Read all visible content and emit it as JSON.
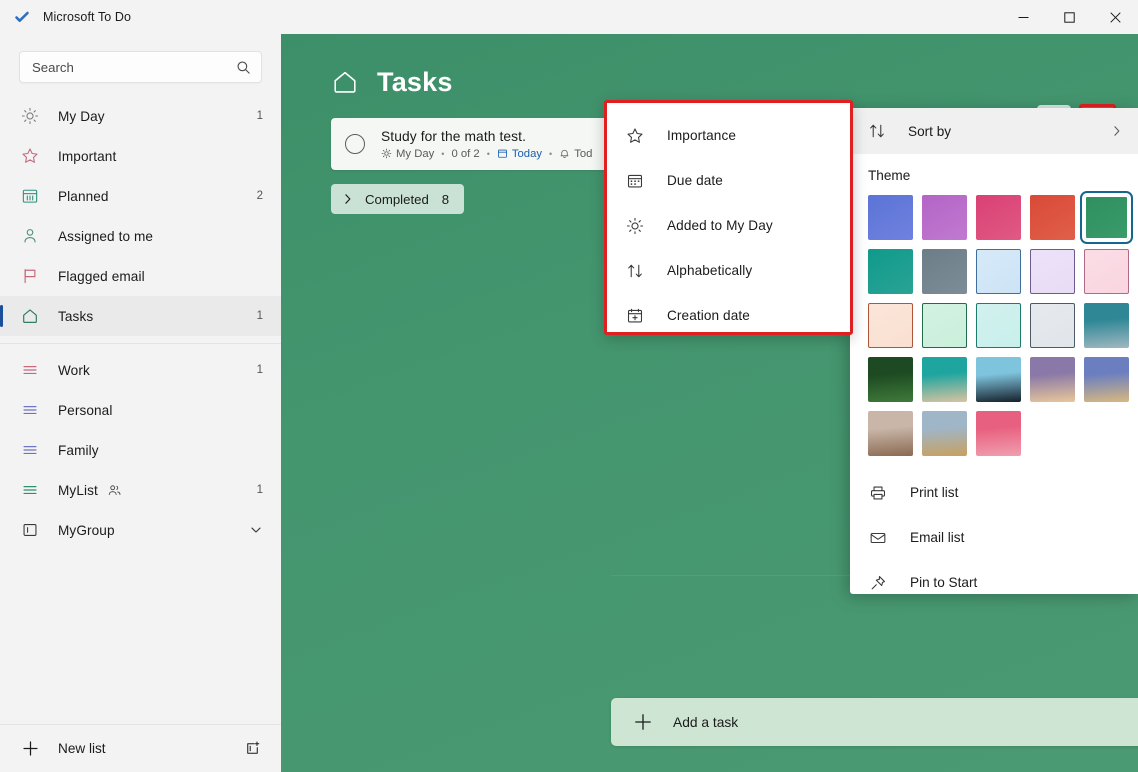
{
  "window": {
    "title": "Microsoft To Do",
    "app_icon": "checkmark-icon",
    "controls": {
      "minimize": "minimize-icon",
      "maximize": "maximize-icon",
      "close": "close-icon"
    }
  },
  "sidebar": {
    "search": {
      "placeholder": "Search",
      "icon": "search-icon"
    },
    "items": [
      {
        "label": "My Day",
        "icon": "sun-icon",
        "count": "1",
        "color": "#7a7a7a",
        "active": false
      },
      {
        "label": "Important",
        "icon": "star-icon",
        "count": "",
        "color": "#c36a7d",
        "active": false
      },
      {
        "label": "Planned",
        "icon": "calendar-icon",
        "count": "2",
        "color": "#2f8f7c",
        "active": false
      },
      {
        "label": "Assigned to me",
        "icon": "person-icon",
        "count": "",
        "color": "#4a8f7a",
        "active": false
      },
      {
        "label": "Flagged email",
        "icon": "flag-icon",
        "count": "",
        "color": "#c36a7d",
        "active": false
      },
      {
        "label": "Tasks",
        "icon": "home-icon",
        "count": "1",
        "color": "#2f7d5e",
        "active": true
      }
    ],
    "lists": [
      {
        "label": "Work",
        "icon": "list-icon",
        "count": "1",
        "color": "#c36a7d",
        "shared": false
      },
      {
        "label": "Personal",
        "icon": "list-icon",
        "count": "",
        "color": "#6f74bf",
        "shared": false
      },
      {
        "label": "Family",
        "icon": "list-icon",
        "count": "",
        "color": "#6f74bf",
        "shared": false
      },
      {
        "label": "MyList",
        "icon": "list-icon",
        "count": "1",
        "color": "#2f8f6c",
        "shared": true,
        "share_icon": "people-icon"
      }
    ],
    "groups": [
      {
        "label": "MyGroup",
        "icon": "group-icon",
        "chevron": "chevron-down-icon"
      }
    ],
    "new_list": {
      "label": "New list",
      "icon": "plus-icon",
      "right_icon": "new-group-icon"
    }
  },
  "main": {
    "title": "Tasks",
    "title_icon": "home-icon",
    "actions": [
      {
        "name": "toggle-detail-view-button",
        "icon": "detail-view-icon"
      },
      {
        "name": "more-options-button",
        "icon": "ellipsis-icon",
        "highlighted": true
      }
    ],
    "task": {
      "title": "Study for the math test.",
      "checkbox": "task-checkbox",
      "meta": {
        "my_day": "My Day",
        "my_day_icon": "sun-icon",
        "steps": "0 of 2",
        "due": "Today",
        "due_icon": "calendar-icon",
        "reminder": "Tod",
        "reminder_icon": "bell-icon",
        "separator": "•"
      }
    },
    "completed": {
      "label": "Completed",
      "count": "8",
      "icon": "chevron-right-icon"
    },
    "add_task": {
      "label": "Add a task",
      "icon": "plus-icon"
    }
  },
  "sort_menu": {
    "highlight_color": "#e02020",
    "items": [
      {
        "label": "Importance",
        "icon": "star-icon"
      },
      {
        "label": "Due date",
        "icon": "calendar-icon"
      },
      {
        "label": "Added to My Day",
        "icon": "sun-icon"
      },
      {
        "label": "Alphabetically",
        "icon": "sort-arrows-icon"
      },
      {
        "label": "Creation date",
        "icon": "calendar-plus-icon"
      }
    ]
  },
  "context_menu": {
    "sort_by": {
      "label": "Sort by",
      "icon": "sort-arrows-icon",
      "chevron": "chevron-right-icon"
    },
    "theme_title": "Theme",
    "selected_theme_index": 4,
    "themes": [
      {
        "name": "blue",
        "type": "solid",
        "from": "#5b74d6",
        "to": "#7081df",
        "border": ""
      },
      {
        "name": "purple",
        "type": "solid",
        "from": "#b464c7",
        "to": "#c07ad0",
        "border": ""
      },
      {
        "name": "pink",
        "type": "solid",
        "from": "#d94074",
        "to": "#e05a85",
        "border": ""
      },
      {
        "name": "red",
        "type": "solid",
        "from": "#d94a37",
        "to": "#e05f48",
        "border": ""
      },
      {
        "name": "green",
        "type": "solid",
        "from": "#2f8f5f",
        "to": "#3a9c6a",
        "border": ""
      },
      {
        "name": "teal",
        "type": "solid",
        "from": "#0f9a8a",
        "to": "#2aa396",
        "border": ""
      },
      {
        "name": "slate",
        "type": "solid",
        "from": "#6d7d88",
        "to": "#7d8d98",
        "border": ""
      },
      {
        "name": "light-blue",
        "type": "light",
        "from": "#d6e9f8",
        "to": "#cde4f6",
        "border": "#3f6f9c"
      },
      {
        "name": "light-purple",
        "type": "light",
        "from": "#ece2f8",
        "to": "#e8dcf6",
        "border": "#6c5b8c"
      },
      {
        "name": "light-pink",
        "type": "light",
        "from": "#fbdde6",
        "to": "#fad5e0",
        "border": "#b06a85"
      },
      {
        "name": "light-peach",
        "type": "light",
        "from": "#fbe6da",
        "to": "#fadfd0",
        "border": "#b0543a"
      },
      {
        "name": "light-mint",
        "type": "light",
        "from": "#d3f2e1",
        "to": "#c9efdb",
        "border": "#1f6b4a"
      },
      {
        "name": "light-aqua",
        "type": "light",
        "from": "#d2f1ee",
        "to": "#c8efec",
        "border": "#1f7a6e"
      },
      {
        "name": "light-gray",
        "type": "light",
        "from": "#e6eaee",
        "to": "#e0e5ea",
        "border": "#4d5a66"
      },
      {
        "name": "photo-tower",
        "type": "photo",
        "from": "#2f8796",
        "to": "#9fb8c0",
        "border": ""
      },
      {
        "name": "photo-fern",
        "type": "photo",
        "from": "#1d4a22",
        "to": "#3f7a3a",
        "border": ""
      },
      {
        "name": "photo-beach",
        "type": "photo",
        "from": "#1fa5a0",
        "to": "#d9c3a0",
        "border": ""
      },
      {
        "name": "photo-dusk",
        "type": "photo",
        "from": "#7fc4dd",
        "to": "#15202c",
        "border": ""
      },
      {
        "name": "photo-sunset",
        "type": "photo",
        "from": "#8a78a8",
        "to": "#e8c79a",
        "border": ""
      },
      {
        "name": "photo-desert",
        "type": "photo",
        "from": "#6b7fc0",
        "to": "#d8b880",
        "border": ""
      },
      {
        "name": "photo-light",
        "type": "photo",
        "from": "#c9b6a8",
        "to": "#8a6a52",
        "border": ""
      },
      {
        "name": "photo-poppy",
        "type": "photo",
        "from": "#9fb6c8",
        "to": "#c8a060",
        "border": ""
      },
      {
        "name": "photo-rose",
        "type": "photo",
        "from": "#e8607f",
        "to": "#f09fb0",
        "border": ""
      }
    ],
    "actions": [
      {
        "label": "Print list",
        "icon": "printer-icon"
      },
      {
        "label": "Email list",
        "icon": "mail-icon"
      },
      {
        "label": "Pin to Start",
        "icon": "pin-icon"
      }
    ]
  }
}
